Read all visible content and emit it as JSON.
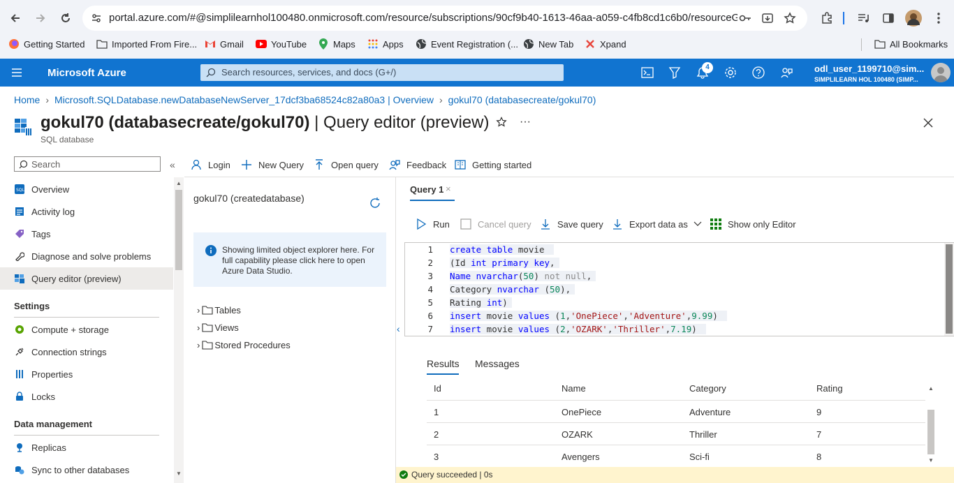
{
  "browser": {
    "url": "portal.azure.com/#@simplilearnhol100480.onmicrosoft.com/resource/subscriptions/90cf9b40-1613-46aa-a059-c4fb8cd1c6b0/resourceGroups/...",
    "bookmarks": [
      "Getting Started",
      "Imported From Fire...",
      "Gmail",
      "YouTube",
      "Maps",
      "Apps",
      "Event Registration (...",
      "New Tab",
      "Xpand"
    ],
    "all_bookmarks": "All Bookmarks"
  },
  "azure": {
    "brand": "Microsoft Azure",
    "search_placeholder": "Search resources, services, and docs (G+/)",
    "notification_count": "4",
    "user_name": "odl_user_1199710@sim...",
    "user_tenant": "SIMPLILEARN HOL 100480 (SIMP..."
  },
  "breadcrumb": [
    "Home",
    "Microsoft.SQLDatabase.newDatabaseNewServer_17dcf3ba68524c82a80a3 | Overview",
    "gokul70 (databasecreate/gokul70)"
  ],
  "page": {
    "title": "gokul70 (databasecreate/gokul70)",
    "title_suffix": " | Query editor (preview)",
    "subtitle": "SQL database"
  },
  "sidebar": {
    "search_placeholder": "Search",
    "items": [
      "Overview",
      "Activity log",
      "Tags",
      "Diagnose and solve problems",
      "Query editor (preview)"
    ],
    "settings_header": "Settings",
    "settings_items": [
      "Compute + storage",
      "Connection strings",
      "Properties",
      "Locks"
    ],
    "data_header": "Data management",
    "data_items": [
      "Replicas",
      "Sync to other databases"
    ]
  },
  "commands": [
    "Login",
    "New Query",
    "Open query",
    "Feedback",
    "Getting started"
  ],
  "explorer": {
    "db_label": "gokul70 (createdatabase)",
    "info": [
      "Showing limited object explorer here. For",
      "full capability please click here to open",
      "Azure Data Studio."
    ],
    "tree": [
      "Tables",
      "Views",
      "Stored Procedures"
    ]
  },
  "editor": {
    "tab": "Query 1",
    "toolbar": [
      "Run",
      "Cancel query",
      "Save query",
      "Export data as",
      "Show only Editor"
    ],
    "line_numbers": [
      "1",
      "2",
      "3",
      "4",
      "5",
      "6",
      "7"
    ]
  },
  "results": {
    "tabs": [
      "Results",
      "Messages"
    ],
    "columns": [
      "Id",
      "Name",
      "Category",
      "Rating"
    ],
    "rows": [
      [
        "1",
        "OnePiece",
        "Adventure",
        "9"
      ],
      [
        "2",
        "OZARK",
        "Thriller",
        "7"
      ],
      [
        "3",
        "Avengers",
        "Sci-fi",
        "8"
      ]
    ]
  },
  "status": "Query succeeded | 0s",
  "colors": {
    "azure_blue": "#1174d0",
    "link": "#0f6cbd",
    "success_bg": "#fff4ce",
    "success_icon": "#107c10"
  }
}
